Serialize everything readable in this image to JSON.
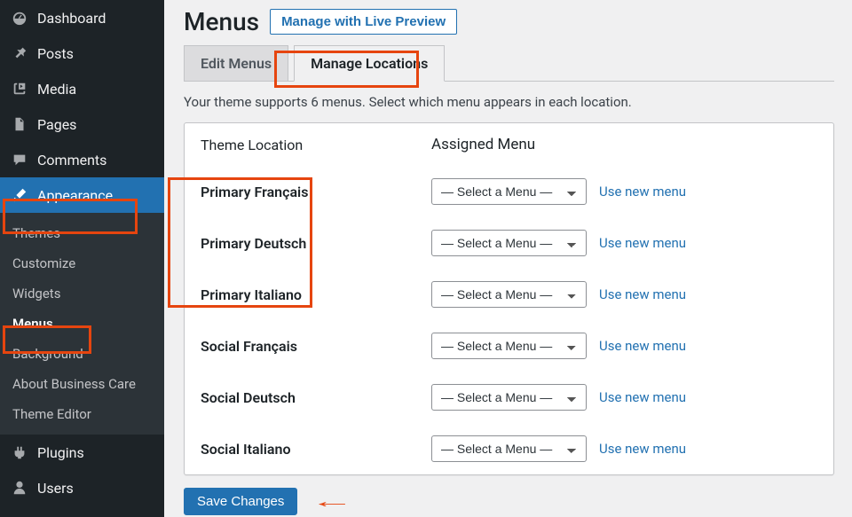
{
  "sidebar": {
    "items": [
      {
        "label": "Dashboard",
        "icon": "gauge"
      },
      {
        "label": "Posts",
        "icon": "pin"
      },
      {
        "label": "Media",
        "icon": "media"
      },
      {
        "label": "Pages",
        "icon": "page"
      },
      {
        "label": "Comments",
        "icon": "comment"
      },
      {
        "label": "Appearance",
        "icon": "brush",
        "active": true
      },
      {
        "label": "Plugins",
        "icon": "plug"
      },
      {
        "label": "Users",
        "icon": "user"
      }
    ],
    "appearance_sub": [
      {
        "label": "Themes"
      },
      {
        "label": "Customize"
      },
      {
        "label": "Widgets"
      },
      {
        "label": "Menus",
        "active": true
      },
      {
        "label": "Background"
      },
      {
        "label": "About Business Care"
      },
      {
        "label": "Theme Editor"
      }
    ]
  },
  "header": {
    "title": "Menus",
    "live_button": "Manage with Live Preview"
  },
  "tabs": {
    "edit": "Edit Menus",
    "manage": "Manage Locations"
  },
  "intro": "Your theme supports 6 menus. Select which menu appears in each location.",
  "table": {
    "col_location": "Theme Location",
    "col_assigned": "Assigned Menu",
    "select_placeholder": "— Select a Menu —",
    "use_new": "Use new menu",
    "rows": [
      {
        "location": "Primary Français"
      },
      {
        "location": "Primary Deutsch"
      },
      {
        "location": "Primary Italiano"
      },
      {
        "location": "Social Français"
      },
      {
        "location": "Social Deutsch"
      },
      {
        "location": "Social Italiano"
      }
    ]
  },
  "save_button": "Save Changes",
  "annotation_color": "#e6450f"
}
